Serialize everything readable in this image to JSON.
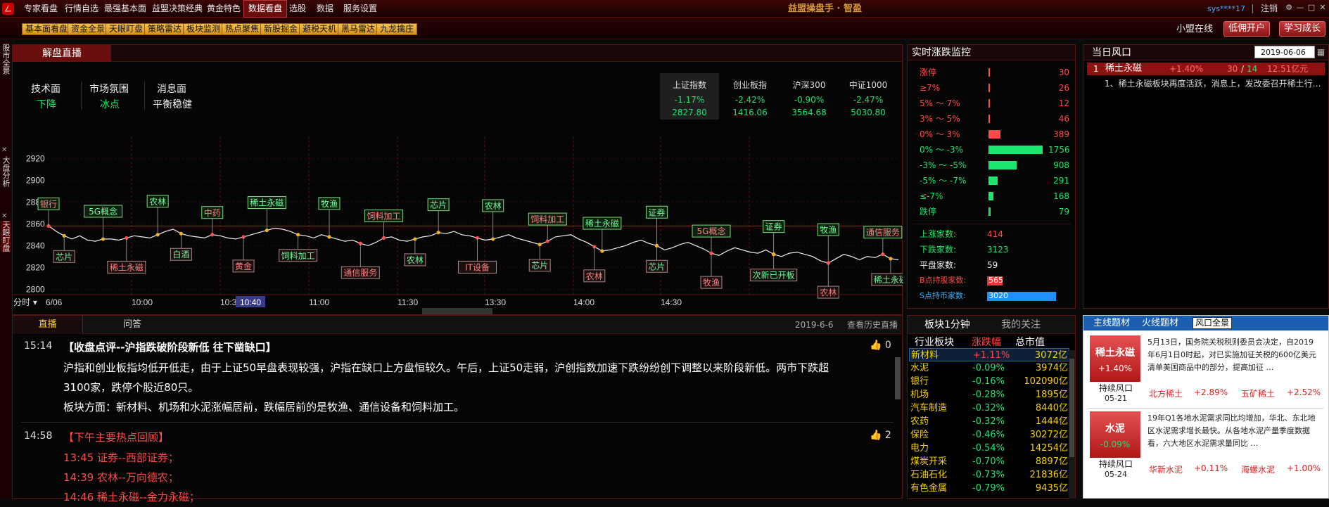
{
  "topmenu": {
    "items": [
      "专家看盘",
      "行情自选",
      "最强基本面",
      "益盟决策经典",
      "黄金特色",
      "数据看盘",
      "选股",
      "数据",
      "服务设置"
    ],
    "active": "数据看盘"
  },
  "app_title": "益盟操盘手 · 智盈",
  "user": "sys****17",
  "logout": "注销",
  "toolbar": {
    "items": [
      "基本面看盘",
      "资金全景",
      "天眼盯盘",
      "策略雷达",
      "板块监测",
      "热点聚焦",
      "新股掘金",
      "避税天机",
      "黑马雷达",
      "九龙擒庄"
    ]
  },
  "online": "小盟在线",
  "buttons": {
    "open": "低佣开户",
    "learn": "学习成长"
  },
  "vtabs": [
    "股市全景",
    "大盘分析",
    "天眼盯盘"
  ],
  "main_panel": {
    "title": "解盘直播"
  },
  "sentiment": {
    "tech_label": "技术面",
    "tech_value": "下降",
    "mood_label": "市场氛围",
    "mood_value": "冰点",
    "news_label": "消息面",
    "news_value": "平衡稳健"
  },
  "indices": [
    {
      "name": "上证指数",
      "pct": "-1.17%",
      "value": "2827.80"
    },
    {
      "name": "创业板指",
      "pct": "-2.42%",
      "value": "1416.06"
    },
    {
      "name": "沪深300",
      "pct": "-0.90%",
      "value": "3564.68"
    },
    {
      "name": "中证1000",
      "pct": "-2.47%",
      "value": "5030.80"
    }
  ],
  "chart_data": {
    "type": "line",
    "y_ticks": [
      "2920",
      "2900",
      "2880",
      "2860",
      "2840",
      "2820",
      "2800"
    ],
    "ylim": [
      2795,
      2935
    ],
    "x_ticks": [
      "6/06",
      "10:00",
      "10:3",
      "11:00",
      "11:30",
      "13:30",
      "14:00",
      "14:30"
    ],
    "x_prefix": "分时",
    "cursor_time": "10:40",
    "ref_line": 2858,
    "values": [
      2858,
      2853,
      2849,
      2846,
      2849,
      2845,
      2844,
      2846,
      2846,
      2845,
      2847,
      2849,
      2848,
      2847,
      2850,
      2853,
      2855,
      2851,
      2849,
      2848,
      2847,
      2850,
      2849,
      2847,
      2846,
      2848,
      2850,
      2852,
      2854,
      2856,
      2855,
      2853,
      2850,
      2849,
      2847,
      2850,
      2848,
      2846,
      2844,
      2845,
      2842,
      2840,
      2843,
      2847,
      2848,
      2845,
      2844,
      2846,
      2848,
      2849,
      2852,
      2851,
      2853,
      2850,
      2849,
      2847,
      2845,
      2846,
      2848,
      2850,
      2847,
      2845,
      2843,
      2841,
      2844,
      2848,
      2849,
      2850,
      2846,
      2843,
      2839,
      2835,
      2836,
      2838,
      2840,
      2843,
      2845,
      2842,
      2840,
      2836,
      2838,
      2841,
      2843,
      2840,
      2837,
      2833,
      2831,
      2835,
      2838,
      2836,
      2834,
      2833,
      2836,
      2832,
      2830,
      2833,
      2834,
      2832,
      2830,
      2826,
      2824,
      2828,
      2832,
      2830,
      2827,
      2830,
      2829,
      2832,
      2828,
      2827
    ],
    "tags_above": [
      "银行",
      "5G概念",
      "农林",
      "中药",
      "稀土永磁",
      "牧渔",
      "饲料加工",
      "芯片",
      "农林",
      "饲料加工",
      "稀土永磁",
      "证券",
      "5G概念",
      "证券",
      "牧渔",
      "通信服务"
    ],
    "tags_below": [
      "芯片",
      "稀土永磁",
      "白酒",
      "黄金",
      "饲料加工",
      "通信服务",
      "农林",
      "IT设备",
      "芯片",
      "农林",
      "芯片",
      "牧渔",
      "次新已开板",
      "农林",
      "稀土永磁"
    ]
  },
  "news_tabs": {
    "live": "直播",
    "qa": "问答",
    "date": "2019-6-6",
    "history": "查看历史直播"
  },
  "news": [
    {
      "time": "15:14",
      "title": "【收盘点评--沪指跌破阶段新低 往下凿缺口】",
      "likes": "0",
      "body": [
        "沪指和创业板指均低开低走，由于上证50早盘表现较强，沪指在缺口上方盘恒较久。午后，上证50走弱，沪创指数加速下跌纷纷创下调整以来阶段新低。两市下跌超",
        "3100家，跌停个股近80只。",
        "板块方面：新材料、机场和水泥涨幅居前，跌幅居前的是牧渔、通信设备和饲料加工。"
      ]
    },
    {
      "time": "14:58",
      "title": "【下午主要热点回顾】",
      "likes": "2",
      "lines": [
        "13:45  证券--西部证券；",
        "14:39  农林--万向德农；",
        "14:46  稀土永磁--金力永磁；"
      ]
    }
  ],
  "monitor": {
    "title": "实时涨跌监控",
    "rows": [
      {
        "label": "涨停",
        "count": "30",
        "color": "#ff4a4a",
        "bar": 0.03
      },
      {
        "label": "≥7%",
        "count": "26",
        "color": "#ff4a4a",
        "bar": 0.02
      },
      {
        "label": "5%  ～  7%",
        "count": "12",
        "color": "#ff4a4a",
        "bar": 0.01
      },
      {
        "label": "3%  ～  5%",
        "count": "46",
        "color": "#ff4a4a",
        "bar": 0.03
      },
      {
        "label": "0%  ～  3%",
        "count": "389",
        "color": "#ff4a4a",
        "bar": 0.22
      },
      {
        "label": "0%  ～  -3%",
        "count": "1756",
        "color": "#18e66f",
        "bar": 1.0
      },
      {
        "label": "-3%  ～  -5%",
        "count": "908",
        "color": "#18e66f",
        "bar": 0.52
      },
      {
        "label": "-5%  ～  -7%",
        "count": "291",
        "color": "#18e66f",
        "bar": 0.17
      },
      {
        "label": "≤-7%",
        "count": "168",
        "color": "#18e66f",
        "bar": 0.09
      },
      {
        "label": "跌停",
        "count": "79",
        "color": "#18e66f",
        "bar": 0.04
      }
    ],
    "up_label": "上涨家数:",
    "up": "414",
    "down_label": "下跌家数:",
    "down": "3123",
    "flat_label": "平盘家数:",
    "flat": "59",
    "b_label": "B点持股家数:",
    "b": "565",
    "s_label": "S点持币家数:",
    "s": "3020"
  },
  "wind": {
    "title": "当日风口",
    "date": "2019-06-06",
    "item": {
      "rank": "1",
      "name": "稀土永磁",
      "pct": "+1.40%",
      "up": "30",
      "total": "14",
      "amount": "12.51亿元",
      "desc": "1、稀土永磁板块再度活跃，消息上，发改委召开稀土行…"
    }
  },
  "sectors": {
    "tabs": [
      "板块1分钟",
      "我的关注"
    ],
    "headers": [
      "行业板块",
      "涨跌幅",
      "总市值"
    ],
    "rows": [
      {
        "name": "新材料",
        "pct": "+1.11%",
        "cap": "3072亿",
        "up": true
      },
      {
        "name": "水泥",
        "pct": "-0.09%",
        "cap": "3974亿"
      },
      {
        "name": "银行",
        "pct": "-0.16%",
        "cap": "102090亿"
      },
      {
        "name": "机场",
        "pct": "-0.28%",
        "cap": "1895亿"
      },
      {
        "name": "汽车制造",
        "pct": "-0.32%",
        "cap": "8440亿"
      },
      {
        "name": "农药",
        "pct": "-0.32%",
        "cap": "1444亿"
      },
      {
        "name": "保险",
        "pct": "-0.46%",
        "cap": "30272亿"
      },
      {
        "name": "电力",
        "pct": "-0.54%",
        "cap": "14254亿"
      },
      {
        "name": "煤炭开采",
        "pct": "-0.70%",
        "cap": "8897亿"
      },
      {
        "name": "石油石化",
        "pct": "-0.73%",
        "cap": "21836亿"
      },
      {
        "name": "有色金属",
        "pct": "-0.79%",
        "cap": "9435亿"
      }
    ]
  },
  "topics": {
    "tabs": [
      "主线题材",
      "火线题材",
      "风口全景"
    ],
    "cards": [
      {
        "name": "稀土永磁",
        "pct": "+1.40%",
        "status": "持续风口",
        "date": "05-21",
        "text": "5月13日，国务院关税税则委员会决定，自2019年6月1日0时起，对已实施加征关税的600亿美元清单美国商品中的部分，提高加征 …",
        "s1": "北方稀土",
        "p1": "+2.89%",
        "s2": "五矿稀土",
        "p2": "+2.52%"
      },
      {
        "name": "水泥",
        "pct": "-0.09%",
        "status": "持续风口",
        "date": "05-24",
        "text": "19年Q1各地水泥需求同比均增加，华北、东北地区水泥需求增长最快。从各地水泥产量季度数据看，六大地区水泥需求量同比 …",
        "s1": "华新水泥",
        "p1": "+0.11%",
        "s2": "海螺水泥",
        "p2": "+1.00%"
      }
    ]
  }
}
